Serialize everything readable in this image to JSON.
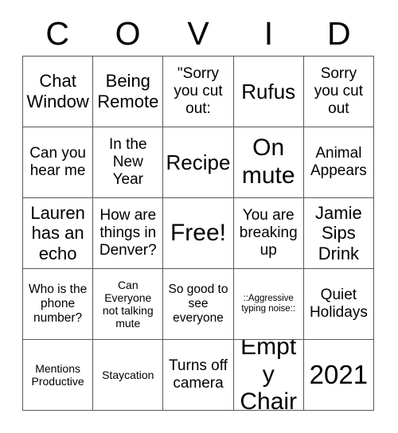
{
  "card": {
    "title_letters": [
      "C",
      "O",
      "V",
      "I",
      "D"
    ],
    "rows": [
      [
        {
          "text": "Chat Window",
          "size": "sz-l"
        },
        {
          "text": "Being Remote",
          "size": "sz-l"
        },
        {
          "text": "\"Sorry you cut out:",
          "size": "sz-ml"
        },
        {
          "text": "Rufus",
          "size": "sz-xl"
        },
        {
          "text": "Sorry you cut out",
          "size": "sz-ml"
        }
      ],
      [
        {
          "text": "Can you hear me",
          "size": "sz-ml"
        },
        {
          "text": "In the New Year",
          "size": "sz-ml"
        },
        {
          "text": "Recipe",
          "size": "sz-xl"
        },
        {
          "text": "On mute",
          "size": "sz-xxl"
        },
        {
          "text": "Animal Appears",
          "size": "sz-ml"
        }
      ],
      [
        {
          "text": "Lauren has an echo",
          "size": "sz-l"
        },
        {
          "text": "How are things in Denver?",
          "size": "sz-ml"
        },
        {
          "text": "Free!",
          "size": "sz-xxl"
        },
        {
          "text": "You are breaking up",
          "size": "sz-ml"
        },
        {
          "text": "Jamie Sips Drink",
          "size": "sz-l"
        }
      ],
      [
        {
          "text": "Who is the phone number?",
          "size": "sz-sm"
        },
        {
          "text": "Can Everyone not talking mute",
          "size": "sz-s"
        },
        {
          "text": "So good to see everyone",
          "size": "sz-sm"
        },
        {
          "text": "::Aggressive typing noise::",
          "size": "sz-xs"
        },
        {
          "text": "Quiet Holidays",
          "size": "sz-ml"
        }
      ],
      [
        {
          "text": "Mentions Productive",
          "size": "sz-s"
        },
        {
          "text": "Staycation",
          "size": "sz-s"
        },
        {
          "text": "Turns off camera",
          "size": "sz-ml"
        },
        {
          "text": "Empty Chair",
          "size": "sz-xxl"
        },
        {
          "text": "2021",
          "size": "sz-huge"
        }
      ]
    ]
  },
  "style": {
    "border_color": "#59595b",
    "text_color": "#000000",
    "background": "#ffffff"
  }
}
